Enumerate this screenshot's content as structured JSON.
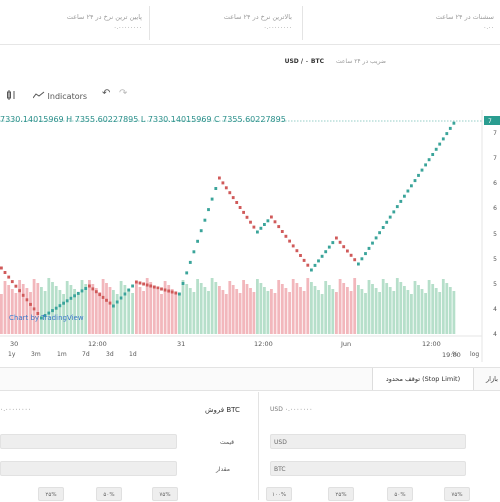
{
  "stats": [
    {
      "label": "پایین ترین نرخ در ۲۴ ساعت",
      "value": "۰.۰۰۰۰۰۰۰۰"
    },
    {
      "label": "بالاترین نرخ در ۲۴ ساعت",
      "value": "۰.۰۰۰۰۰۰۰۰"
    },
    {
      "label": "سشنات در ۲۴ ساعت",
      "value": "۰.۰۰"
    }
  ],
  "pair": {
    "title": "USD / ٠ BTC",
    "subtitle": "ضریب در ۲۴ ساعت"
  },
  "toolbar": {
    "indicators": "Indicators",
    "undo": "↶",
    "redo": "↷"
  },
  "ohlc": "7330.14015969 H 7355.60227895 L 7330.14015969 C 7355.60227895",
  "watermark": "Chart by TradingView",
  "timeframes": [
    "1y",
    "3m",
    "1m",
    "7d",
    "3d",
    "1d"
  ],
  "date_labels": [
    "30",
    "12:00",
    "31",
    "12:00",
    "Jun",
    "12:00",
    "19:00"
  ],
  "price_ticks": [
    "7",
    "7",
    "6",
    "6",
    "5",
    "5",
    "5",
    "4",
    "4"
  ],
  "price_flag": "7",
  "axis_buttons": [
    "%",
    "log"
  ],
  "order_tabs": [
    "بازار",
    "توقف محدود (Stop Limit)"
  ],
  "forms": {
    "left_title": "فروش BTC",
    "left_balance": "۰.۰۰۰۰۰۰۰۰",
    "right_balance": "USD ٠.٠٠٠٠٠٠٠",
    "price_label": "قیمت",
    "amount_label": "مقدار",
    "usd_unit": "USD",
    "btc_unit": "BTC"
  },
  "percent_buttons": [
    "۲۵%",
    "۵۰%",
    "۷۵%",
    "۱۰۰%",
    "۲۵%",
    "۵۰%",
    "۷۵%",
    "۱۰۰%"
  ],
  "chart_data": {
    "type": "renko",
    "description_series": "price bricks rising from ~4 to ~7 with volume bars",
    "up_color": "#3aa49a",
    "down_color": "#d05a5a",
    "volume_up_color": "#b6dfca",
    "volume_down_color": "#f2b7bc"
  }
}
